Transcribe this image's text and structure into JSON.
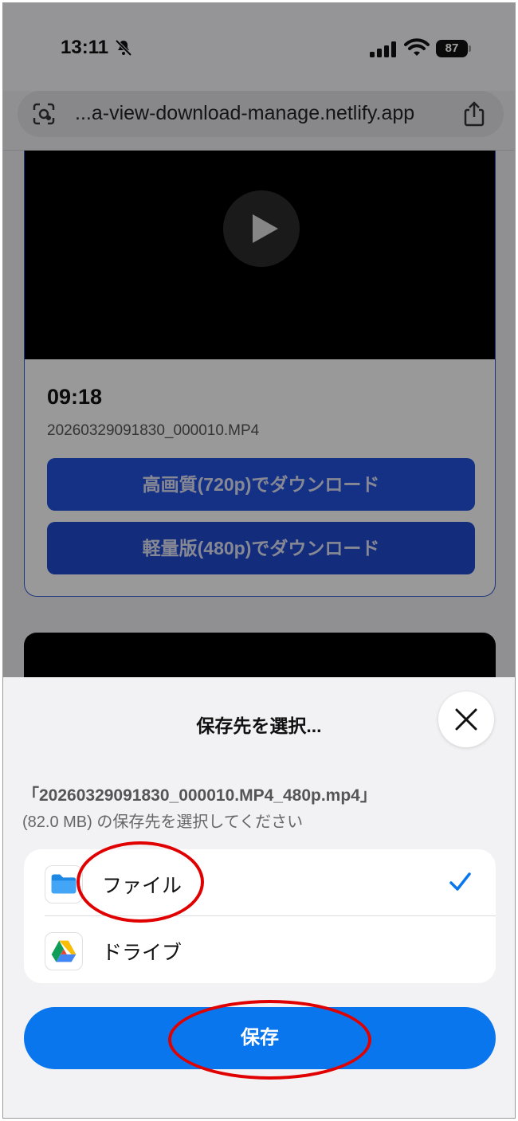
{
  "status_bar": {
    "time": "13:11",
    "battery": "87",
    "icons": [
      "bell-slash-icon",
      "cellular-signal-icon",
      "wifi-icon",
      "battery-icon"
    ]
  },
  "browser": {
    "url": "...a-view-download-manage.netlify.app",
    "icons": [
      "scan-icon",
      "share-icon"
    ]
  },
  "video_card": {
    "time": "09:18",
    "filename": "20260329091830_000010.MP4",
    "buttons": {
      "high_quality": "高画質(720p)でダウンロード",
      "light": "軽量版(480p)でダウンロード"
    }
  },
  "sheet": {
    "title": "保存先を選択...",
    "close_icon": "close-icon",
    "file_line": "「20260329091830_000010.MP4_480p.mp4」",
    "size_line": "(82.0 MB) の保存先を選択してください",
    "options": [
      {
        "label": "ファイル",
        "icon": "folder-icon",
        "selected": true
      },
      {
        "label": "ドライブ",
        "icon": "google-drive-icon",
        "selected": false
      }
    ],
    "save_label": "保存"
  },
  "colors": {
    "accent": "#0a76ee",
    "download_button": "#2350d9",
    "annotation": "#e00000"
  }
}
